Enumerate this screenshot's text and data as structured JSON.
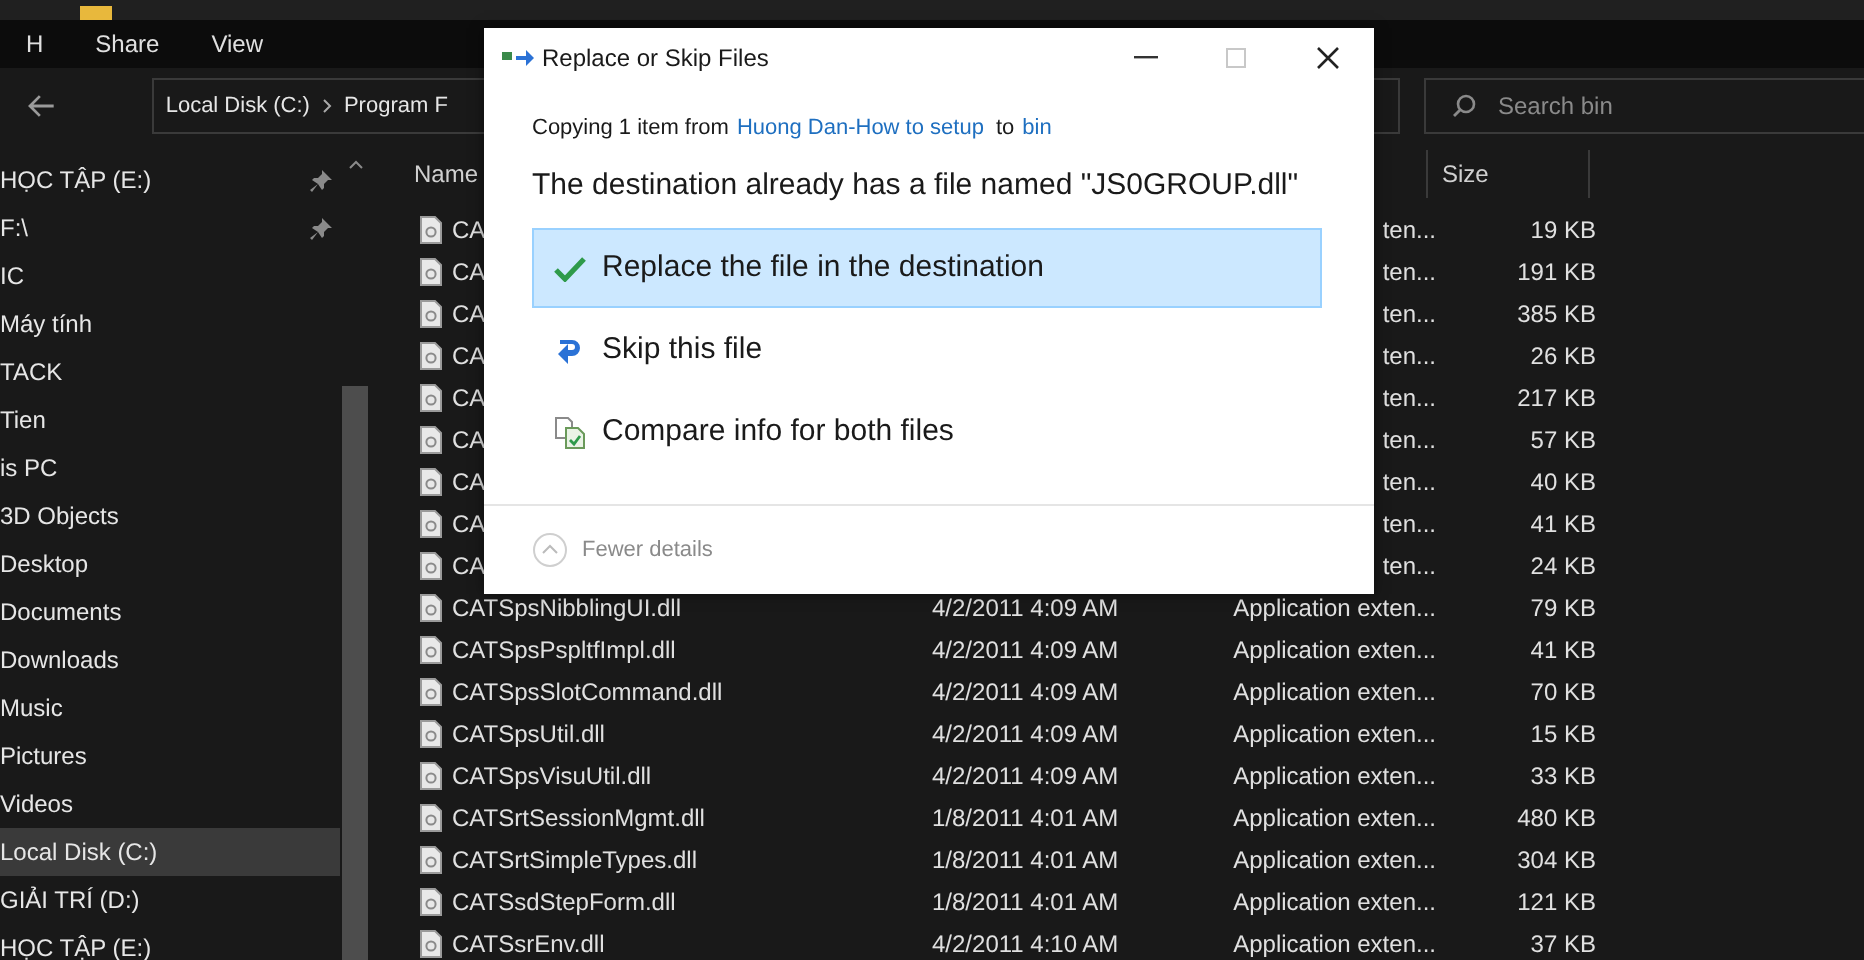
{
  "ribbon_tabs": [
    {
      "label": "H"
    },
    {
      "label": "Share"
    },
    {
      "label": "View"
    }
  ],
  "address_bar": {
    "parts": [
      "Local Disk (C:)",
      "Program F"
    ]
  },
  "search": {
    "placeholder": "Search bin"
  },
  "sidebar": {
    "items": [
      {
        "label": "HỌC TẬP (E:)",
        "pinned": true,
        "selected": false
      },
      {
        "label": "F:\\",
        "pinned": true,
        "selected": false
      },
      {
        "label": "IC",
        "pinned": false,
        "selected": false
      },
      {
        "label": "Máy tính",
        "pinned": false,
        "selected": false
      },
      {
        "label": "TACK",
        "pinned": false,
        "selected": false
      },
      {
        "label": "Tien",
        "pinned": false,
        "selected": false
      },
      {
        "label": "is PC",
        "pinned": false,
        "selected": false
      },
      {
        "label": "3D Objects",
        "pinned": false,
        "selected": false
      },
      {
        "label": "Desktop",
        "pinned": false,
        "selected": false
      },
      {
        "label": "Documents",
        "pinned": false,
        "selected": false
      },
      {
        "label": "Downloads",
        "pinned": false,
        "selected": false
      },
      {
        "label": "Music",
        "pinned": false,
        "selected": false
      },
      {
        "label": "Pictures",
        "pinned": false,
        "selected": false
      },
      {
        "label": "Videos",
        "pinned": false,
        "selected": false
      },
      {
        "label": "Local Disk (C:)",
        "pinned": false,
        "selected": true
      },
      {
        "label": "GIẢI TRÍ (D:)",
        "pinned": false,
        "selected": false
      },
      {
        "label": "HỌC TẬP (E:)",
        "pinned": false,
        "selected": false
      }
    ]
  },
  "table": {
    "columns": [
      "Name",
      "Size"
    ],
    "rows": [
      {
        "name": "CA",
        "type": "ten...",
        "size": "19 KB"
      },
      {
        "name": "CA",
        "type": "ten...",
        "size": "191 KB"
      },
      {
        "name": "CA",
        "type": "ten...",
        "size": "385 KB"
      },
      {
        "name": "CA",
        "type": "ten...",
        "size": "26 KB"
      },
      {
        "name": "CA",
        "type": "ten...",
        "size": "217 KB"
      },
      {
        "name": "CA",
        "type": "ten...",
        "size": "57 KB"
      },
      {
        "name": "CA",
        "type": "ten...",
        "size": "40 KB"
      },
      {
        "name": "CA",
        "type": "ten...",
        "size": "41 KB"
      },
      {
        "name": "CA",
        "type": "ten...",
        "size": "24 KB"
      },
      {
        "name": "CATSpsNibblingUI.dll",
        "date": "4/2/2011 4:09 AM",
        "type": "Application exten...",
        "size": "79 KB"
      },
      {
        "name": "CATSpsPspltfImpl.dll",
        "date": "4/2/2011 4:09 AM",
        "type": "Application exten...",
        "size": "41 KB"
      },
      {
        "name": "CATSpsSlotCommand.dll",
        "date": "4/2/2011 4:09 AM",
        "type": "Application exten...",
        "size": "70 KB"
      },
      {
        "name": "CATSpsUtil.dll",
        "date": "4/2/2011 4:09 AM",
        "type": "Application exten...",
        "size": "15 KB"
      },
      {
        "name": "CATSpsVisuUtil.dll",
        "date": "4/2/2011 4:09 AM",
        "type": "Application exten...",
        "size": "33 KB"
      },
      {
        "name": "CATSrtSessionMgmt.dll",
        "date": "1/8/2011 4:01 AM",
        "type": "Application exten...",
        "size": "480 KB"
      },
      {
        "name": "CATSrtSimpleTypes.dll",
        "date": "1/8/2011 4:01 AM",
        "type": "Application exten...",
        "size": "304 KB"
      },
      {
        "name": "CATSsdStepForm.dll",
        "date": "1/8/2011 4:01 AM",
        "type": "Application exten...",
        "size": "121 KB"
      },
      {
        "name": "CATSsrEnv.dll",
        "date": "4/2/2011 4:10 AM",
        "type": "Application exten...",
        "size": "37 KB"
      }
    ]
  },
  "dialog": {
    "title": "Replace or Skip Files",
    "copying": {
      "prefix": "Copying 1 item from",
      "source": "Huong Dan-How to setup",
      "middle": "to",
      "target": "bin"
    },
    "message": "The destination already has a file named \"JS0GROUP.dll\"",
    "options": [
      {
        "kind": "replace",
        "label": "Replace the file in the destination",
        "selected": true
      },
      {
        "kind": "skip",
        "label": "Skip this file",
        "selected": false
      },
      {
        "kind": "compare",
        "label": "Compare info for both files",
        "selected": false
      }
    ],
    "details_toggle": "Fewer details"
  }
}
